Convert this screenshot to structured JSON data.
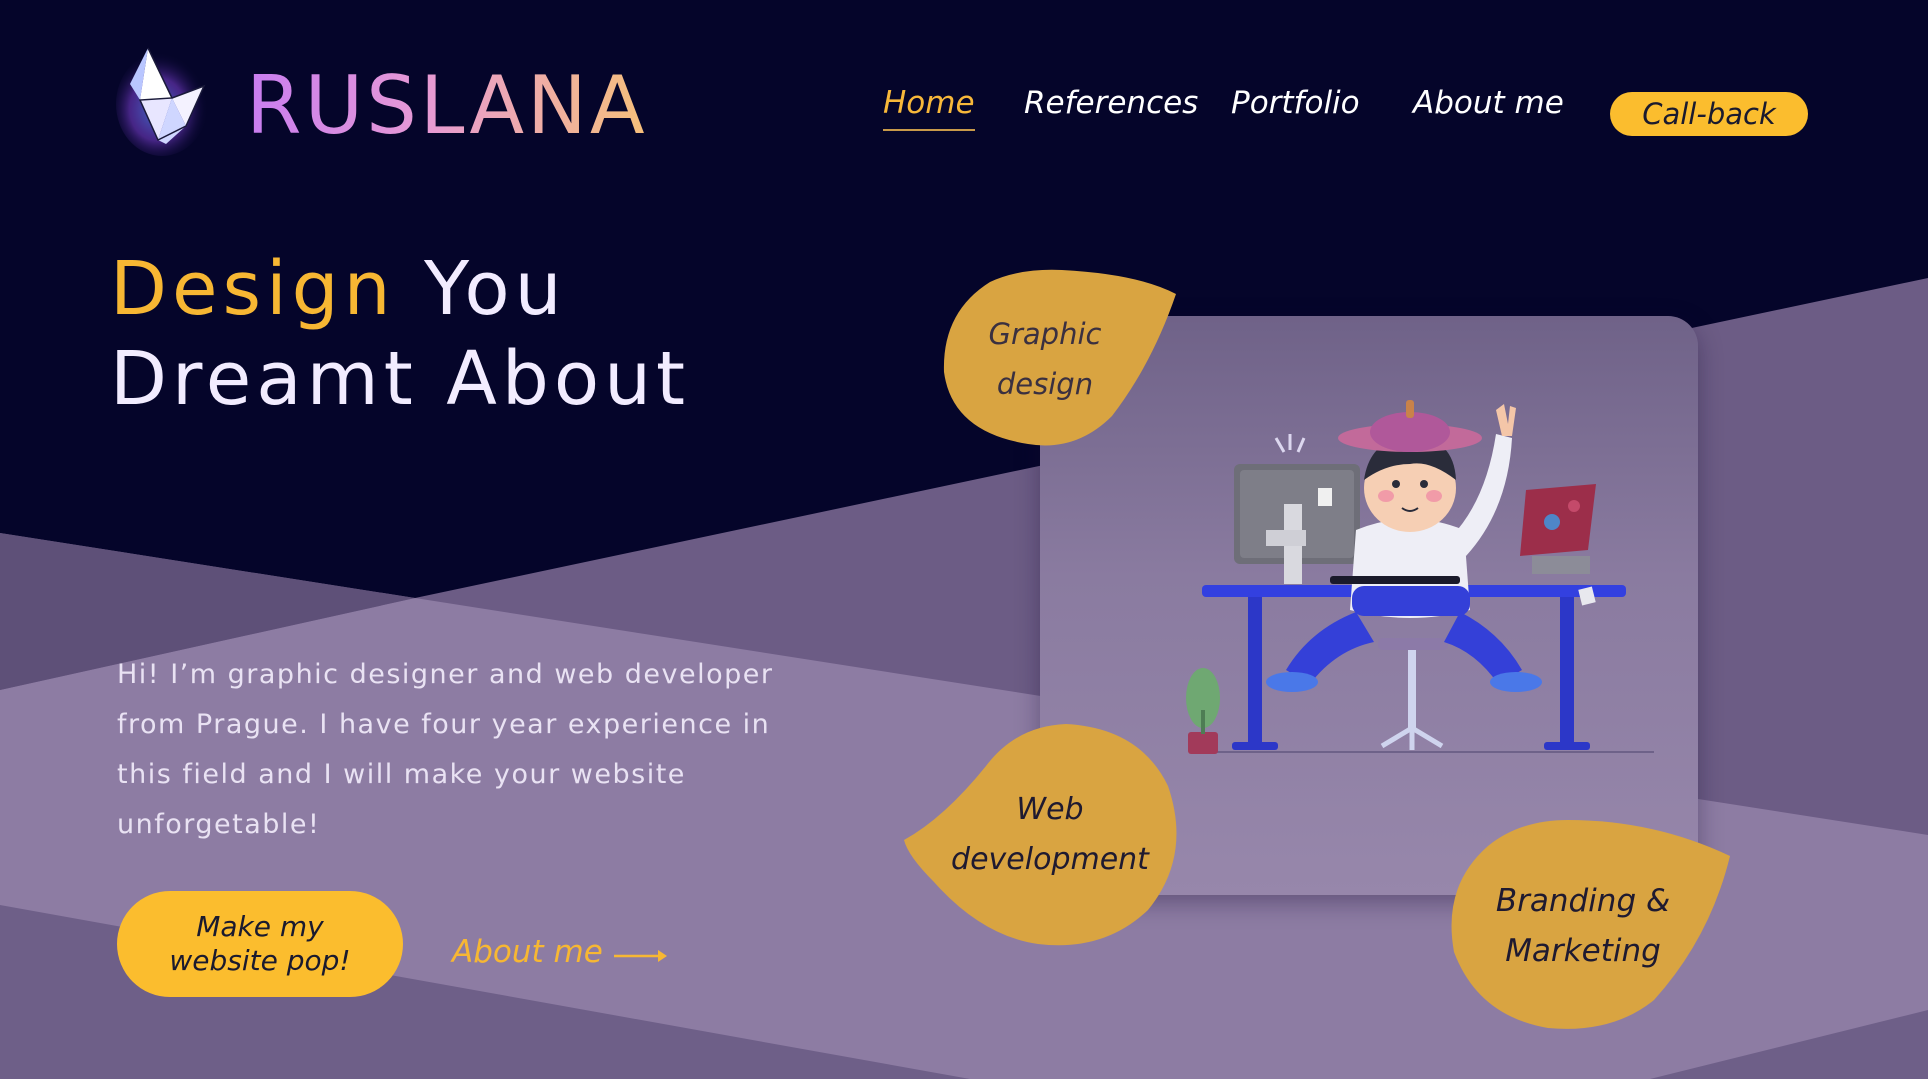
{
  "brand": {
    "name": "RUSLANA",
    "logo_icon": "origami-crane-icon"
  },
  "nav": {
    "items": [
      {
        "label": "Home",
        "active": true
      },
      {
        "label": "References",
        "active": false
      },
      {
        "label": "Portfolio",
        "active": false
      },
      {
        "label": "About me",
        "active": false
      }
    ],
    "callback_label": "Call-back"
  },
  "hero": {
    "line1_accent": "Design",
    "line1_rest": " You",
    "line2": "Dreamt About"
  },
  "intro": "Hi! I’m graphic designer and web developer from Prague. I have four year experience in this field and I will make your website unforgetable!",
  "cta": {
    "label": "Make my website pop!"
  },
  "about_link": {
    "label": "About me",
    "icon": "arrow-right-icon"
  },
  "services": [
    {
      "label": "Graphic\ndesign"
    },
    {
      "label": "Web\ndevelopment"
    },
    {
      "label": "Branding &\nMarketing"
    }
  ],
  "colors": {
    "background": "#05052a",
    "accent": "#fbbd2e",
    "accent_text": "#f7b733",
    "blob": "#d9a441",
    "purple_light": "#8f7ea3",
    "purple_dark": "#6c5c85"
  }
}
